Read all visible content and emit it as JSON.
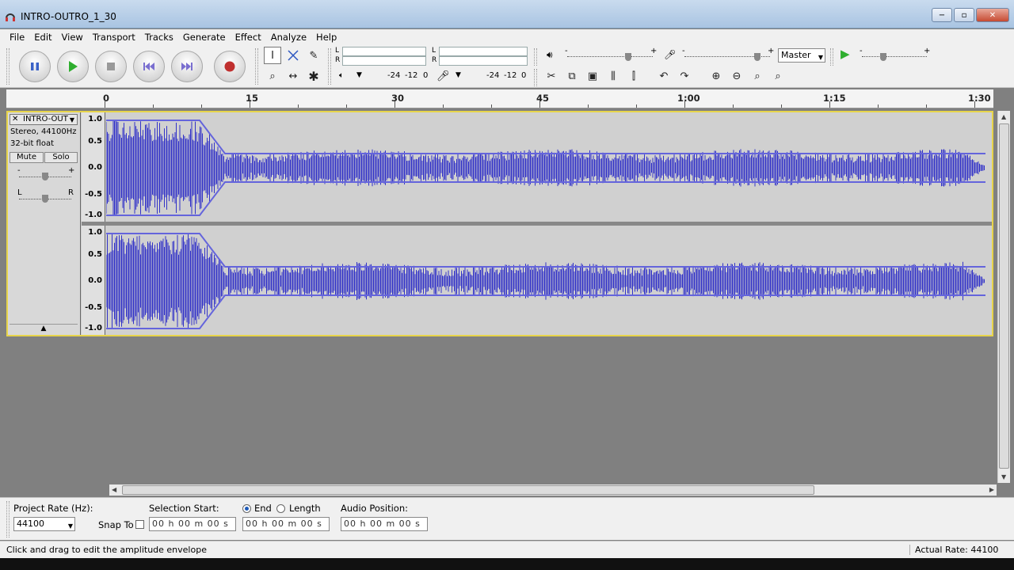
{
  "window": {
    "title": "INTRO-OUTRO_1_30",
    "minimize": "−",
    "maximize": "▫",
    "close": "✕"
  },
  "menu": [
    "File",
    "Edit",
    "View",
    "Transport",
    "Tracks",
    "Generate",
    "Effect",
    "Analyze",
    "Help"
  ],
  "meters": {
    "play_L": "L",
    "play_R": "R",
    "rec_L": "L",
    "rec_R": "R",
    "play_scale": [
      "-24",
      "-12",
      "0"
    ],
    "rec_scale": [
      "-24",
      "-12",
      "0"
    ]
  },
  "mixer": {
    "minus1": "-",
    "plus1": "+",
    "minus2": "-",
    "plus2": "+",
    "minus3": "-",
    "plus3": "+",
    "input_source": "Master"
  },
  "ruler": {
    "labels": [
      "0",
      "15",
      "30",
      "45",
      "1:00",
      "1:15",
      "1:30"
    ]
  },
  "track": {
    "name": "INTRO-OUT",
    "info_line1": "Stereo, 44100Hz",
    "info_line2": "32-bit float",
    "mute": "Mute",
    "solo": "Solo",
    "gain_minus": "-",
    "gain_plus": "+",
    "pan_left": "L",
    "pan_right": "R",
    "scale": [
      "1.0",
      "0.5",
      "0.0",
      "-0.5",
      "-1.0"
    ]
  },
  "selection": {
    "project_rate_label": "Project Rate (Hz):",
    "project_rate_value": "44100",
    "snap_to_label": "Snap To",
    "selection_start_label": "Selection Start:",
    "end_label": "End",
    "length_label": "Length",
    "audio_position_label": "Audio Position:",
    "start_time": "00 h 00 m 00 s",
    "end_time": "00 h 00 m 00 s",
    "audio_position": "00 h 00 m 00 s"
  },
  "status": {
    "message": "Click and drag to edit the amplitude envelope",
    "actual_rate": "Actual Rate: 44100"
  },
  "colors": {
    "waveform": "#3232c8",
    "envelope": "#6464dc",
    "track_bg": "#d0d0d0",
    "selected_border": "#e7d44a"
  }
}
